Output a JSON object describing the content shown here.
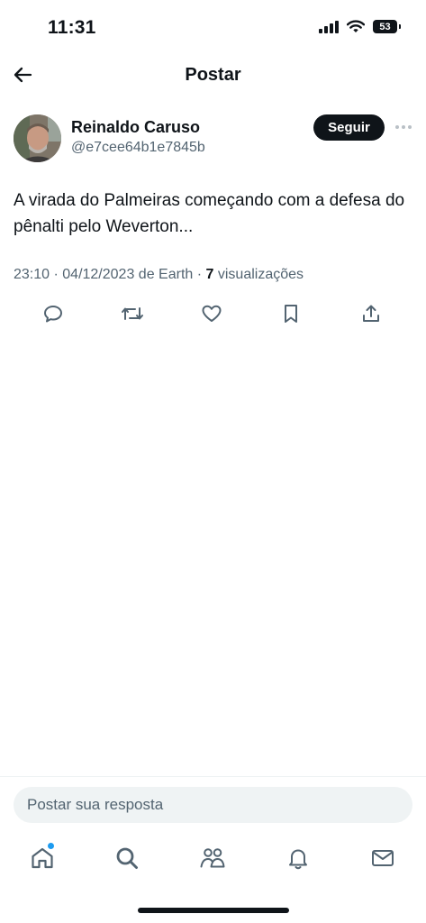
{
  "status_bar": {
    "time": "11:31",
    "battery": "53"
  },
  "header": {
    "title": "Postar"
  },
  "post": {
    "author_name": "Reinaldo Caruso",
    "author_handle": "@e7cee64b1e7845b",
    "follow_label": "Seguir",
    "text": "A virada do Palmeiras começando com a defesa do pênalti pelo Weverton...",
    "time": "23:10",
    "date": "04/12/2023",
    "location": "de Earth",
    "views_count": "7",
    "views_label": "visualizações"
  },
  "actions": [
    {
      "name": "reply",
      "icon": "comment-icon"
    },
    {
      "name": "repost",
      "icon": "repost-icon"
    },
    {
      "name": "like",
      "icon": "heart-icon"
    },
    {
      "name": "bookmark",
      "icon": "bookmark-icon"
    },
    {
      "name": "share",
      "icon": "share-icon"
    }
  ],
  "reply": {
    "placeholder": "Postar sua resposta"
  },
  "tab_bar": [
    {
      "name": "home",
      "icon": "home-icon",
      "has_notification_dot": true
    },
    {
      "name": "search",
      "icon": "search-icon"
    },
    {
      "name": "communities",
      "icon": "communities-icon"
    },
    {
      "name": "notifications",
      "icon": "bell-icon"
    },
    {
      "name": "messages",
      "icon": "mail-icon"
    }
  ],
  "colors": {
    "text": "#0f1419",
    "secondary_text": "#536471",
    "accent": "#1d9bf0",
    "reply_background": "#eff3f4"
  }
}
